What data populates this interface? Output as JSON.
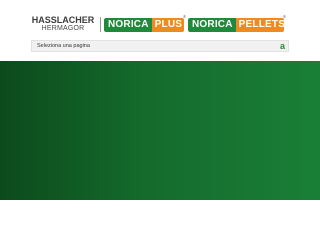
{
  "header": {
    "brand_main": "HASSLACHER",
    "brand_sub": "HERMAGOR",
    "badges": [
      {
        "part_a": "NORICA",
        "part_b": "PLUS",
        "trademark": "®"
      },
      {
        "part_a": "NORICA",
        "part_b": "PELLETS",
        "trademark": "®"
      }
    ]
  },
  "page_select": {
    "label": "Seleziona una pagina",
    "toggle": "a"
  },
  "colors": {
    "badge_green": "#1e8a3a",
    "badge_orange": "#f08a1e",
    "hero_start": "#0c4a1c",
    "hero_end": "#1a7f36",
    "toggle_green": "#2a8a2a"
  }
}
